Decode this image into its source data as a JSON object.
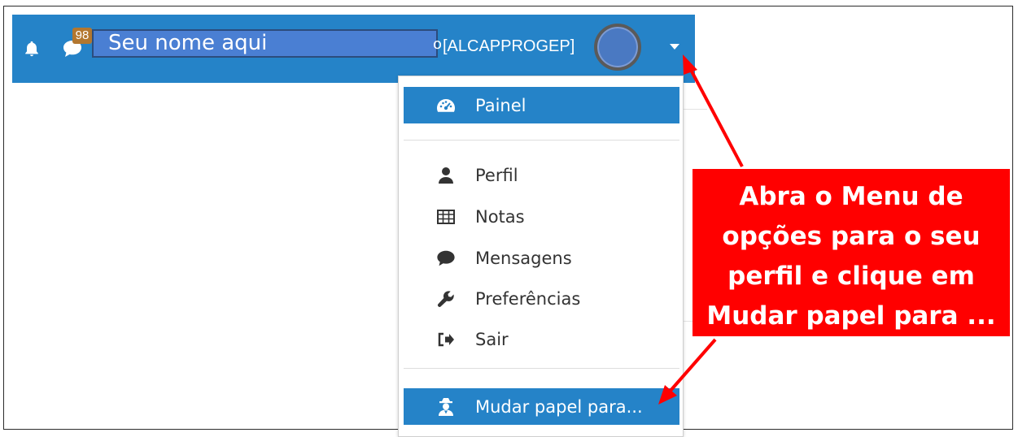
{
  "navbar": {
    "notification_count": "98",
    "user_name": "Seu nome aqui",
    "name_tail": "o",
    "org_code": "[ALCAPPROGEP]",
    "icons": {
      "bell": "bell-icon",
      "chat": "chat-icon",
      "avatar": "user-avatar",
      "caret": "chevron-down-icon"
    }
  },
  "menu": {
    "items": [
      {
        "label": "Painel",
        "icon": "dashboard-icon"
      },
      {
        "label": "Perfil",
        "icon": "user-icon"
      },
      {
        "label": "Notas",
        "icon": "table-icon"
      },
      {
        "label": "Mensagens",
        "icon": "comment-icon"
      },
      {
        "label": "Preferências",
        "icon": "wrench-icon"
      },
      {
        "label": "Sair",
        "icon": "sign-out-icon"
      },
      {
        "label": "Mudar papel para...",
        "icon": "user-secret-icon"
      }
    ]
  },
  "annotation": {
    "lines": [
      "Abra o Menu de",
      "opções para o seu",
      "perfil e clique em",
      "Mudar papel para ..."
    ]
  },
  "colors": {
    "navbar": "#2583c8",
    "active_item": "#2583c8",
    "callout": "#ff0000",
    "arrow": "#ff0000",
    "badge": "#b3772f"
  }
}
